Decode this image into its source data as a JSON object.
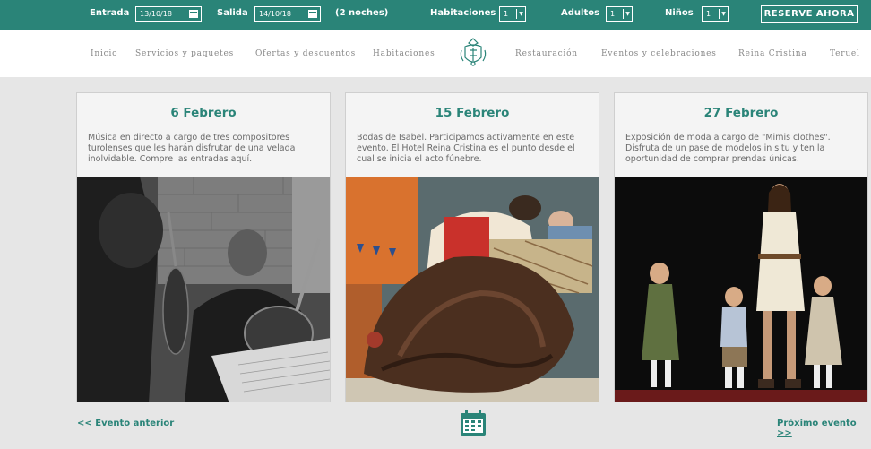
{
  "booking": {
    "checkin_label": "Entrada",
    "checkin_value": "13/10/18",
    "checkout_label": "Salida",
    "checkout_value": "14/10/18",
    "nights": "(2 noches)",
    "rooms_label": "Habitaciones",
    "rooms_value": "1",
    "adults_label": "Adultos",
    "adults_value": "1",
    "children_label": "Niños",
    "children_value": "1",
    "reserve_button": "RESERVE AHORA"
  },
  "nav": {
    "items": [
      "Inicio",
      "Servicios y paquetes",
      "Ofertas y descuentos",
      "Habitaciones",
      "Restauración",
      "Eventos y celebraciones",
      "Reina Cristina",
      "Teruel"
    ]
  },
  "events": [
    {
      "title": "6 Febrero",
      "description": "Música en directo a cargo de tres compositores turolenses que les harán disfrutar de una velada inolvidable. Compre las entradas aquí."
    },
    {
      "title": "15 Febrero",
      "description": "Bodas de Isabel. Participamos activamente en este evento. El Hotel Reina Cristina es el punto desde el cual se inicia el acto fúnebre."
    },
    {
      "title": "27 Febrero",
      "description": "Exposición de moda a cargo de \"Mimis clothes\". Disfruta de un pase de modelos in situ y ten la oportunidad de comprar prendas únicas."
    }
  ],
  "footer": {
    "prev_label": "<< Evento anterior",
    "next_label": "Próximo evento >>"
  },
  "colors": {
    "accent": "#2a8478",
    "background": "#e6e6e6"
  },
  "icons": {
    "logo": "hotel-crest-icon",
    "calendar": "calendar-icon"
  }
}
